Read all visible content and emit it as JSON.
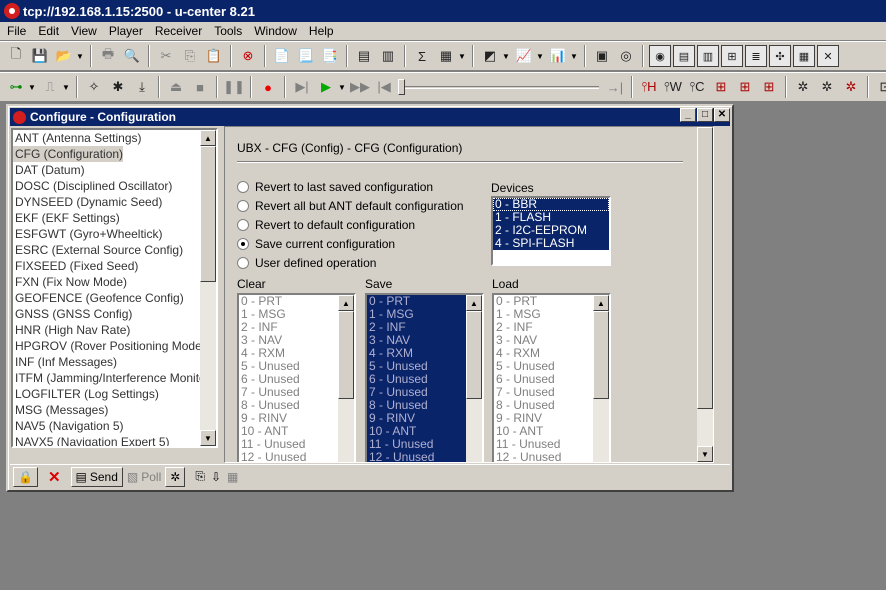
{
  "app": {
    "title": "tcp://192.168.1.15:2500 - u-center 8.21"
  },
  "menu": [
    "File",
    "Edit",
    "View",
    "Player",
    "Receiver",
    "Tools",
    "Window",
    "Help"
  ],
  "window": {
    "title": "Configure - Configuration"
  },
  "messages": [
    "ANT (Antenna Settings)",
    "CFG (Configuration)",
    "DAT (Datum)",
    "DOSC (Disciplined Oscillator)",
    "DYNSEED (Dynamic Seed)",
    "EKF (EKF Settings)",
    "ESFGWT (Gyro+Wheeltick)",
    "ESRC (External Source Config)",
    "FIXSEED (Fixed Seed)",
    "FXN (Fix Now Mode)",
    "GEOFENCE (Geofence Config)",
    "GNSS (GNSS Config)",
    "HNR (High Nav Rate)",
    "HPGROV (Rover Positioning Mode)",
    "INF (Inf Messages)",
    "ITFM (Jamming/Interference Monitor)",
    "LOGFILTER (Log Settings)",
    "MSG (Messages)",
    "NAV5 (Navigation 5)",
    "NAVX5 (Navigation Expert 5)"
  ],
  "selected_message_index": 1,
  "panel": {
    "heading": "UBX - CFG (Config) - CFG (Configuration)",
    "options": [
      {
        "label": "Revert to last saved configuration",
        "checked": false
      },
      {
        "label": "Revert all but ANT default configuration",
        "checked": false
      },
      {
        "label": "Revert to default configuration",
        "checked": false
      },
      {
        "label": "Save current configuration",
        "checked": true
      },
      {
        "label": "User defined operation",
        "checked": false
      }
    ],
    "devices_label": "Devices",
    "devices": [
      "0 - BBR",
      "1 - FLASH",
      "2 - I2C-EEPROM",
      "4 - SPI-FLASH"
    ],
    "clear_label": "Clear",
    "save_label": "Save",
    "load_label": "Load",
    "sections": [
      "0 - PRT",
      "1 - MSG",
      "2 - INF",
      "3 - NAV",
      "4 - RXM",
      "5 - Unused",
      "6 - Unused",
      "7 - Unused",
      "8 - Unused",
      "9 - RINV",
      "10 - ANT",
      "11 - Unused",
      "12 - Unused"
    ]
  },
  "bottom": {
    "send": "Send",
    "poll": "Poll"
  },
  "toolbar1_icons": [
    "new-icon",
    "save-icon",
    "open-icon",
    "print-icon",
    "print-preview-icon",
    "cut-icon",
    "copy-icon",
    "paste-icon",
    "stop-icon",
    "docs-icon",
    "docs2-icon",
    "docs3-icon",
    "view1-icon",
    "view2-icon",
    "sigma-icon",
    "table-icon",
    "chart-icon",
    "line-chart-icon",
    "bar-chart-icon",
    "window-icon",
    "radar-icon",
    "pane1-icon",
    "pane2-icon",
    "pane3-icon",
    "pane4-icon",
    "pane5-icon",
    "pane6-icon",
    "pane7-icon",
    "pane8-icon"
  ],
  "toolbar2_icons": [
    "connect-icon",
    "baud-icon",
    "wand-icon",
    "bug-icon",
    "download-icon",
    "eject-icon",
    "stop-icon",
    "pause-icon",
    "record-icon",
    "step-icon",
    "play-icon",
    "fast-forward-icon",
    "rewind-icon",
    "end-icon",
    "hot-start-icon",
    "warm-start-icon",
    "cold-start-icon",
    "reset-icon",
    "msg-icon",
    "msg2-icon",
    "config-icon",
    "config2-icon",
    "config3-icon",
    "extra-icon"
  ]
}
